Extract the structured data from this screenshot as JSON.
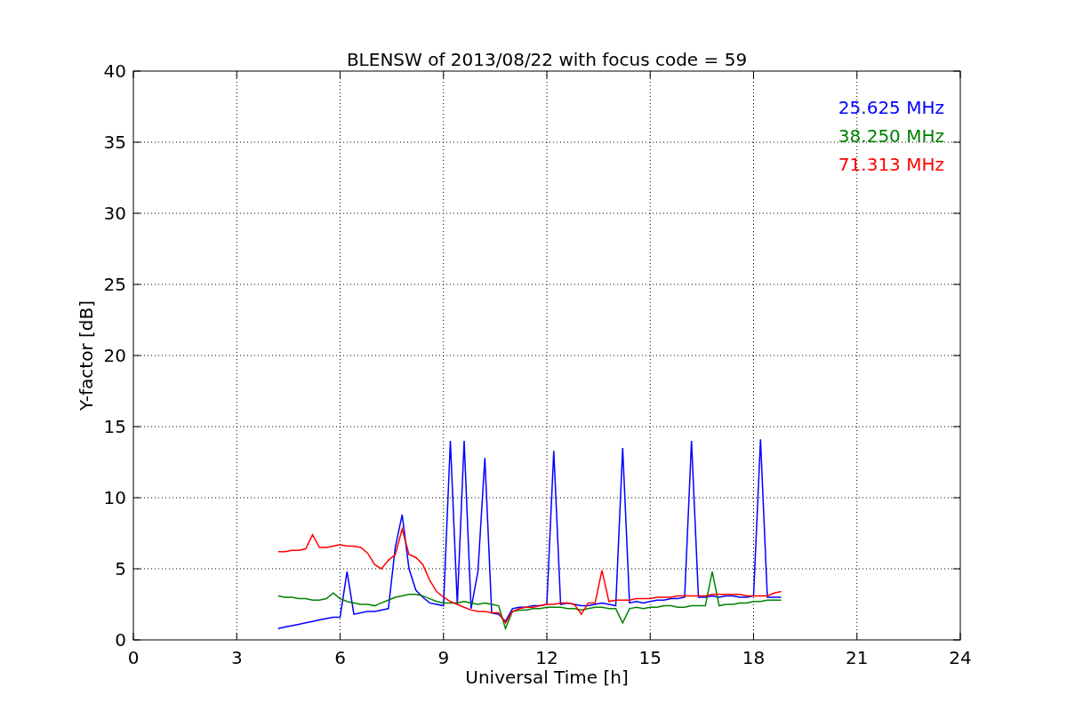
{
  "chart_data": {
    "type": "line",
    "grid": true,
    "title": "BLENSW of 2013/08/22 with focus code = 59",
    "xlabel": "Universal Time [h]",
    "ylabel": "Y-factor [dB]",
    "xlim": [
      0,
      24
    ],
    "ylim": [
      0,
      40
    ],
    "xticks": [
      0,
      3,
      6,
      9,
      12,
      15,
      18,
      21,
      24
    ],
    "yticks": [
      0,
      5,
      10,
      15,
      20,
      25,
      30,
      35,
      40
    ],
    "x": [
      4.2,
      4.4,
      4.6,
      4.8,
      5.0,
      5.2,
      5.4,
      5.6,
      5.8,
      6.0,
      6.2,
      6.4,
      6.6,
      6.8,
      7.0,
      7.2,
      7.4,
      7.6,
      7.8,
      8.0,
      8.2,
      8.4,
      8.6,
      8.8,
      9.0,
      9.2,
      9.4,
      9.6,
      9.8,
      10.0,
      10.2,
      10.4,
      10.6,
      10.8,
      11.0,
      11.2,
      11.4,
      11.6,
      11.8,
      12.0,
      12.2,
      12.4,
      12.6,
      12.8,
      13.0,
      13.2,
      13.4,
      13.6,
      13.8,
      14.0,
      14.2,
      14.4,
      14.6,
      14.8,
      15.0,
      15.2,
      15.4,
      15.6,
      15.8,
      16.0,
      16.2,
      16.4,
      16.6,
      16.8,
      17.0,
      17.2,
      17.4,
      17.6,
      17.8,
      18.0,
      18.2,
      18.4,
      18.6,
      18.8
    ],
    "series": [
      {
        "name": "25.625 MHz",
        "color": "#0000ff",
        "values": [
          0.8,
          0.9,
          1.0,
          1.1,
          1.2,
          1.3,
          1.4,
          1.5,
          1.6,
          1.6,
          4.8,
          1.8,
          1.9,
          2.0,
          2.0,
          2.1,
          2.2,
          6.5,
          8.8,
          5.0,
          3.5,
          3.0,
          2.6,
          2.5,
          2.4,
          14.0,
          2.5,
          14.0,
          2.2,
          4.8,
          12.8,
          1.9,
          1.8,
          1.3,
          2.2,
          2.3,
          2.3,
          2.4,
          2.4,
          2.5,
          13.3,
          2.5,
          2.6,
          2.5,
          2.4,
          2.4,
          2.5,
          2.6,
          2.5,
          2.4,
          13.5,
          2.6,
          2.7,
          2.6,
          2.7,
          2.8,
          2.8,
          2.9,
          2.9,
          3.0,
          14.0,
          3.0,
          3.0,
          3.1,
          3.0,
          3.1,
          3.1,
          3.0,
          3.0,
          3.1,
          14.1,
          3.0,
          3.0,
          3.0
        ]
      },
      {
        "name": "38.250 MHz",
        "color": "#008000",
        "values": [
          3.1,
          3.0,
          3.0,
          2.9,
          2.9,
          2.8,
          2.8,
          2.9,
          3.3,
          2.9,
          2.7,
          2.6,
          2.5,
          2.5,
          2.4,
          2.6,
          2.8,
          3.0,
          3.1,
          3.2,
          3.2,
          3.1,
          2.9,
          2.7,
          2.6,
          2.6,
          2.6,
          2.7,
          2.6,
          2.5,
          2.6,
          2.5,
          2.4,
          0.8,
          2.0,
          2.1,
          2.1,
          2.2,
          2.2,
          2.3,
          2.3,
          2.3,
          2.2,
          2.2,
          2.1,
          2.2,
          2.3,
          2.3,
          2.2,
          2.2,
          1.2,
          2.2,
          2.3,
          2.2,
          2.3,
          2.3,
          2.4,
          2.4,
          2.3,
          2.3,
          2.4,
          2.4,
          2.4,
          4.8,
          2.4,
          2.5,
          2.5,
          2.6,
          2.6,
          2.7,
          2.7,
          2.8,
          2.8,
          2.8
        ]
      },
      {
        "name": "71.313 MHz",
        "color": "#ff0000",
        "values": [
          6.2,
          6.2,
          6.3,
          6.3,
          6.4,
          7.4,
          6.5,
          6.5,
          6.6,
          6.7,
          6.6,
          6.6,
          6.5,
          6.1,
          5.3,
          5.0,
          5.6,
          6.0,
          7.8,
          6.0,
          5.8,
          5.3,
          4.2,
          3.4,
          3.0,
          2.7,
          2.5,
          2.3,
          2.1,
          2.0,
          2.0,
          1.9,
          1.9,
          1.2,
          2.0,
          2.2,
          2.3,
          2.3,
          2.4,
          2.5,
          2.5,
          2.6,
          2.6,
          2.5,
          1.8,
          2.6,
          2.6,
          4.9,
          2.7,
          2.8,
          2.8,
          2.8,
          2.9,
          2.9,
          2.9,
          3.0,
          3.0,
          3.0,
          3.1,
          3.1,
          3.1,
          3.1,
          3.1,
          3.2,
          3.2,
          3.2,
          3.2,
          3.2,
          3.1,
          3.1,
          3.1,
          3.1,
          3.3,
          3.4
        ]
      }
    ]
  }
}
